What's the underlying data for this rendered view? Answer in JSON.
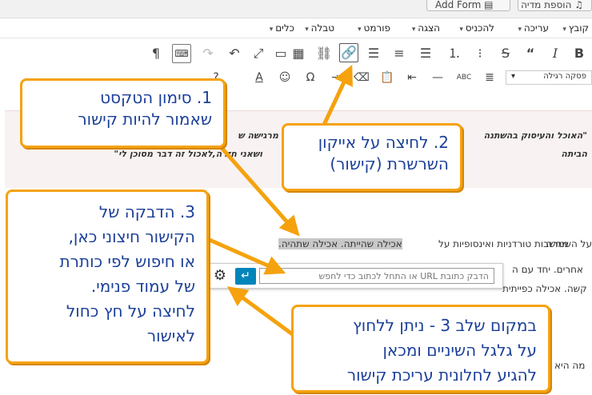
{
  "top_buttons": {
    "add_media": "הוספת מדיה",
    "add_form": "Add Form"
  },
  "menu": [
    "קובץ",
    "עריכה",
    "להכניס",
    "הצגה",
    "פורמט",
    "טבלה",
    "כלים"
  ],
  "format_select": "פסקה רגילה",
  "toolbar": {
    "bold": "B",
    "italic": "I",
    "quote": "“",
    "more": "ABC"
  },
  "quote": {
    "line1": "\"האוכל והעיסוק בהשתנה",
    "line1b": "מרגישה ש",
    "line2": "הביתה",
    "line2b": "ושאני חזרה,לאכול זה דבר מסוכן לי\""
  },
  "body": {
    "line1_sel": "אכילה שהייתה. אכילה שתהיה.",
    "line1_before": "על השמרה",
    "line1_after": "מחשבות טורדניות ואינסופיות על",
    "line2_left": "אחרים. יחד עם ה",
    "line3_left": "קשה. אכילה כפייתית",
    "line4": "מה היא"
  },
  "link_editor": {
    "placeholder": "הדבק כתובת URL או התחל לכתוב כדי לחפש"
  },
  "callouts": {
    "c1": [
      "1. סימון הטקסט",
      "שאמור להיות קישור"
    ],
    "c2": [
      "2. לחיצה על אייקון",
      "השרשרת (קישור)"
    ],
    "c3": [
      "3. הדבקה של",
      "הקישור חיצוני כאן,",
      "או חיפוש לפי כותרת",
      "של עמוד פנימי.",
      "לחיצה על חץ כחול",
      "לאישור"
    ],
    "c4": [
      "במקום שלב 3 - ניתן ללחוץ",
      "על גלגל השיניים ומכאן",
      "להגיע לחלונית עריכת קישור"
    ]
  },
  "colors": {
    "callout_border": "#f5a20e",
    "callout_text": "#1b3f99",
    "apply": "#0085ba"
  }
}
